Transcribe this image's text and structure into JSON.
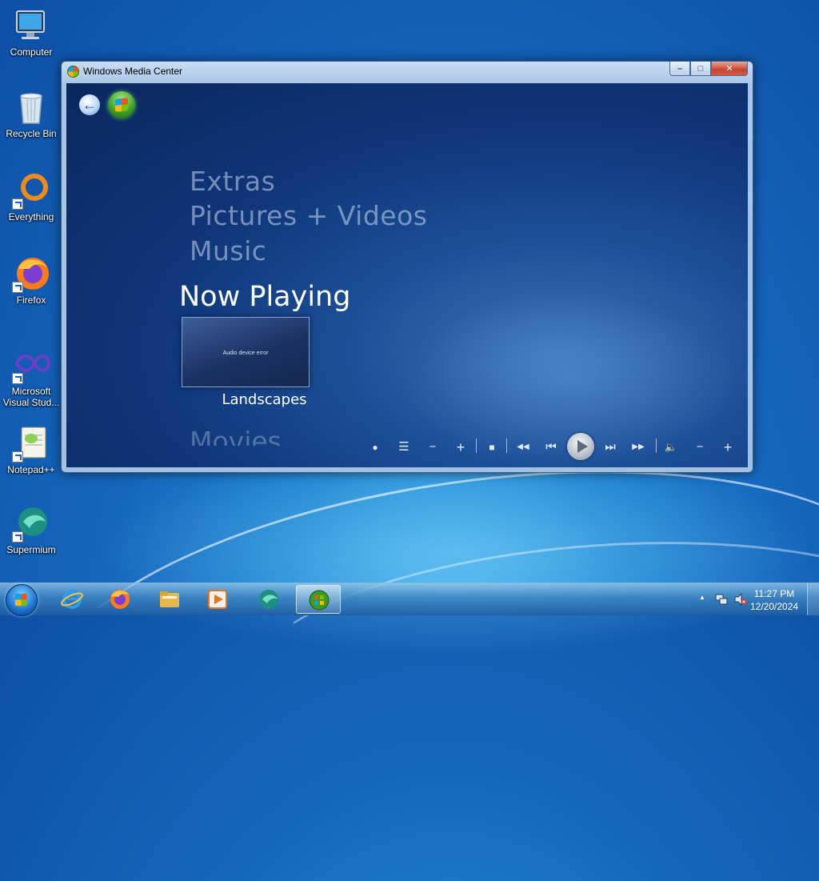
{
  "desktop": {
    "icons": [
      {
        "label": "Computer"
      },
      {
        "label": "Recycle Bin"
      },
      {
        "label": "Everything"
      },
      {
        "label": "Firefox"
      },
      {
        "label": "Microsoft Visual Stud..."
      },
      {
        "label": "Notepad++"
      },
      {
        "label": "Supermium"
      }
    ]
  },
  "window": {
    "title": "Windows Media Center",
    "controls": {
      "minimize": "–",
      "maximize": "□",
      "close": "✕"
    }
  },
  "media_center": {
    "back_icon": "back-arrow-icon",
    "start_icon": "windows-start-icon",
    "menu": [
      "Extras",
      "Pictures + Videos",
      "Music"
    ],
    "selected": "Now Playing",
    "tile": {
      "text": "Audio device error",
      "caption": "Landscapes"
    },
    "next_item": "Movies",
    "transport": {
      "record": "●",
      "guide": "☰",
      "channel_down": "−",
      "channel_up": "+",
      "stop": "■",
      "rewind": "◀◀",
      "previous": "⏮",
      "next": "⏭",
      "fast_forward": "▶▶",
      "mute": "🔈",
      "volume_down": "−",
      "volume_up": "+"
    }
  },
  "taskbar": {
    "items": [
      "internet-explorer",
      "firefox",
      "file-explorer",
      "media-player",
      "supermium",
      "windows-media-center"
    ],
    "tray": {
      "time": "11:27 PM",
      "date": "12/20/2024",
      "expand": "▲"
    }
  }
}
